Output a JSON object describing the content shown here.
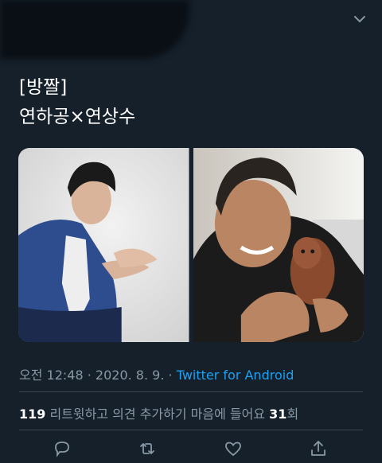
{
  "tweet": {
    "line1": "[방짤]",
    "line2": "연하공×연상수"
  },
  "meta": {
    "time": "오전 12:48",
    "sep1": " · ",
    "date": "2020. 8. 9.",
    "sep2": " · ",
    "source": "Twitter for Android"
  },
  "stats": {
    "retweets_count": "119",
    "retweets_label": " 리트윗하고 의견 추가하기  마음에 들어요 ",
    "likes_count": "31",
    "likes_suffix": "회"
  },
  "icons": {
    "menu": "chevron-down-icon",
    "reply": "reply-icon",
    "retweet": "retweet-icon",
    "like": "heart-icon",
    "share": "share-icon"
  },
  "colors": {
    "background": "#15202b",
    "secondary_text": "#8899a6",
    "link": "#1da1f2",
    "divider": "#38444d"
  }
}
